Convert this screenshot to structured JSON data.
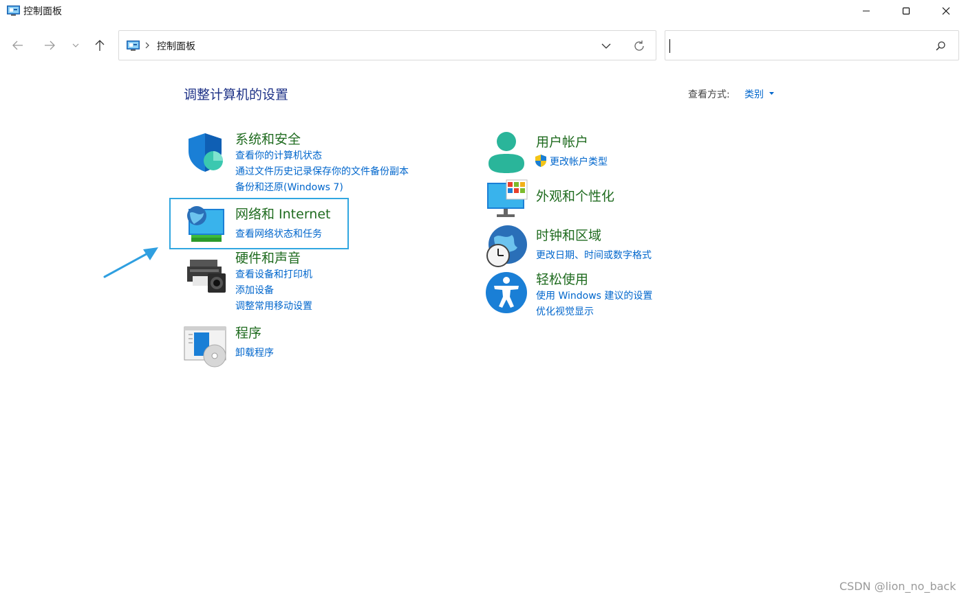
{
  "window": {
    "title": "控制面板"
  },
  "nav": {
    "back": "back-arrow",
    "forward": "forward-arrow",
    "recent": "chevron-down",
    "up": "up-arrow"
  },
  "address": {
    "crumb": "控制面板"
  },
  "search": {
    "value": "",
    "placeholder": ""
  },
  "main": {
    "heading": "调整计算机的设置",
    "view_by_label": "查看方式:",
    "view_by_value": "类别"
  },
  "categories": {
    "security": {
      "title": "系统和安全",
      "links": [
        "查看你的计算机状态",
        "通过文件历史记录保存你的文件备份副本",
        "备份和还原(Windows 7)"
      ]
    },
    "network": {
      "title": "网络和 Internet",
      "links": [
        "查看网络状态和任务"
      ]
    },
    "hardware": {
      "title": "硬件和声音",
      "links": [
        "查看设备和打印机",
        "添加设备",
        "调整常用移动设置"
      ]
    },
    "programs": {
      "title": "程序",
      "links": [
        "卸载程序"
      ]
    },
    "accounts": {
      "title": "用户帐户",
      "links": [
        "更改帐户类型"
      ]
    },
    "appearance": {
      "title": "外观和个性化",
      "links": []
    },
    "clock": {
      "title": "时钟和区域",
      "links": [
        "更改日期、时间或数字格式"
      ]
    },
    "ease": {
      "title": "轻松使用",
      "links": [
        "使用 Windows 建议的设置",
        "优化视觉显示"
      ]
    }
  },
  "watermark": "CSDN @lion_no_back",
  "colors": {
    "heading": "#1e3287",
    "category_title": "#1f6b1f",
    "link": "#0066cc",
    "highlight": "#30a6e0"
  }
}
